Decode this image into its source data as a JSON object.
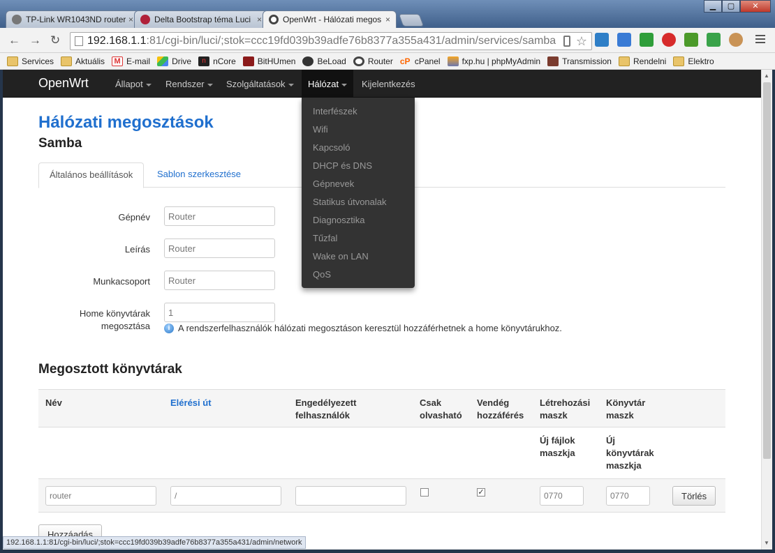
{
  "browser": {
    "tabs": [
      {
        "title": "TP-Link WR1043ND router",
        "close": "×",
        "color": "#777777"
      },
      {
        "title": "Delta Bootstrap téma Luci",
        "close": "×",
        "color": "#b0213a"
      },
      {
        "title": "OpenWrt - Hálózati megos",
        "close": "×",
        "color": "#444444"
      }
    ],
    "url_host": "192.168.1.1",
    "url_rest": ":81/cgi-bin/luci/;stok=ccc19fd039b39adfe76b8377a355a431/admin/services/samba",
    "bookmarks": [
      {
        "label": "Services",
        "icon": "folder-icon"
      },
      {
        "label": "Aktuális",
        "icon": "folder-icon"
      },
      {
        "label": "E-mail",
        "icon": "gmail-icon"
      },
      {
        "label": "Drive",
        "icon": "drive-icon"
      },
      {
        "label": "nCore",
        "icon": "ncore-icon"
      },
      {
        "label": "BitHUmen",
        "icon": "bithumen-icon"
      },
      {
        "label": "BeLoad",
        "icon": "beload-icon"
      },
      {
        "label": "Router",
        "icon": "openwrt-icon"
      },
      {
        "label": "cPanel",
        "icon": "cpanel-icon"
      },
      {
        "label": "fxp.hu | phpMyAdmin",
        "icon": "phpmyadmin-icon"
      },
      {
        "label": "Transmission",
        "icon": "transmission-icon"
      },
      {
        "label": "Rendelni",
        "icon": "folder-icon"
      },
      {
        "label": "Elektro",
        "icon": "folder-icon"
      }
    ],
    "status_url": "192.168.1.1:81/cgi-bin/luci/;stok=ccc19fd039b39adfe76b8377a355a431/admin/network"
  },
  "nav": {
    "brand": "OpenWrt",
    "items": [
      {
        "label": "Állapot"
      },
      {
        "label": "Rendszer"
      },
      {
        "label": "Szolgáltatások"
      },
      {
        "label": "Hálózat"
      },
      {
        "label": "Kijelentkezés"
      }
    ],
    "dropdown": [
      "Interfészek",
      "Wifi",
      "Kapcsoló",
      "DHCP és DNS",
      "Gépnevek",
      "Statikus útvonalak",
      "Diagnosztika",
      "Tűzfal",
      "Wake on LAN",
      "QoS"
    ]
  },
  "page": {
    "title": "Hálózati megosztások",
    "subtitle": "Samba",
    "tabs": [
      "Általános beállítások",
      "Sablon szerkesztése"
    ]
  },
  "form": {
    "hostname_label": "Gépnév",
    "hostname_value": "Router",
    "description_label": "Leírás",
    "description_value": "Router",
    "workgroup_label": "Munkacsoport",
    "workgroup_value": "Router",
    "homes_label_1": "Home könyvtárak",
    "homes_label_2": "megosztása",
    "homes_value": "1",
    "homes_hint": "A rendszerfelhasználók hálózati megosztáson keresztül hozzáférhetnek a home könyvtárukhoz."
  },
  "shares": {
    "title": "Megosztott könyvtárak",
    "headers": {
      "name": "Név",
      "path": "Elérési út",
      "users_1": "Engedélyezett",
      "users_2": "felhasználók",
      "ro_1": "Csak",
      "ro_2": "olvasható",
      "guest_1": "Vendég",
      "guest_2": "hozzáférés",
      "cmask_1": "Létrehozási",
      "cmask_2": "maszk",
      "dmask_1": "Könyvtár",
      "dmask_2": "maszk"
    },
    "subheaders": {
      "cmask_1": "Új fájlok",
      "cmask_2": "maszkja",
      "dmask_1": "Új",
      "dmask_2": "könyvtárak",
      "dmask_3": "maszkja"
    },
    "rows": [
      {
        "name": "router",
        "path": "/",
        "users": "",
        "read_only": false,
        "guest_ok": true,
        "create_mask": "0770",
        "dir_mask": "0770",
        "delete": "Törlés"
      }
    ],
    "add_button": "Hozzáadás"
  }
}
